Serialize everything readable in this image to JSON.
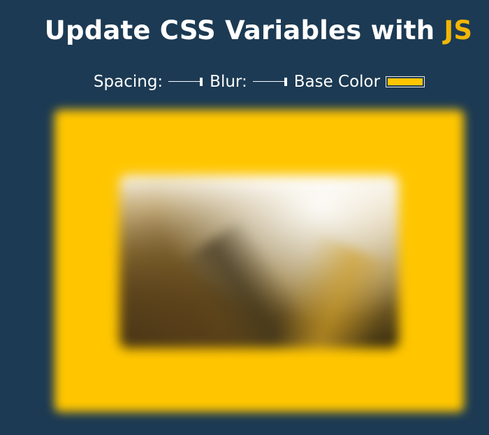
{
  "header": {
    "title_prefix": "Update CSS Variables with ",
    "title_accent": "JS"
  },
  "controls": {
    "spacing_label": "Spacing:",
    "spacing_value_fraction": 1,
    "blur_label": "Blur:",
    "blur_value_fraction": 1,
    "base_color_label": "Base Color",
    "base_color_value": "#ffc600"
  },
  "colors": {
    "background": "#1c3a53",
    "accent": "#f2b705",
    "frame": "#ffc600",
    "text": "#ffffff"
  }
}
